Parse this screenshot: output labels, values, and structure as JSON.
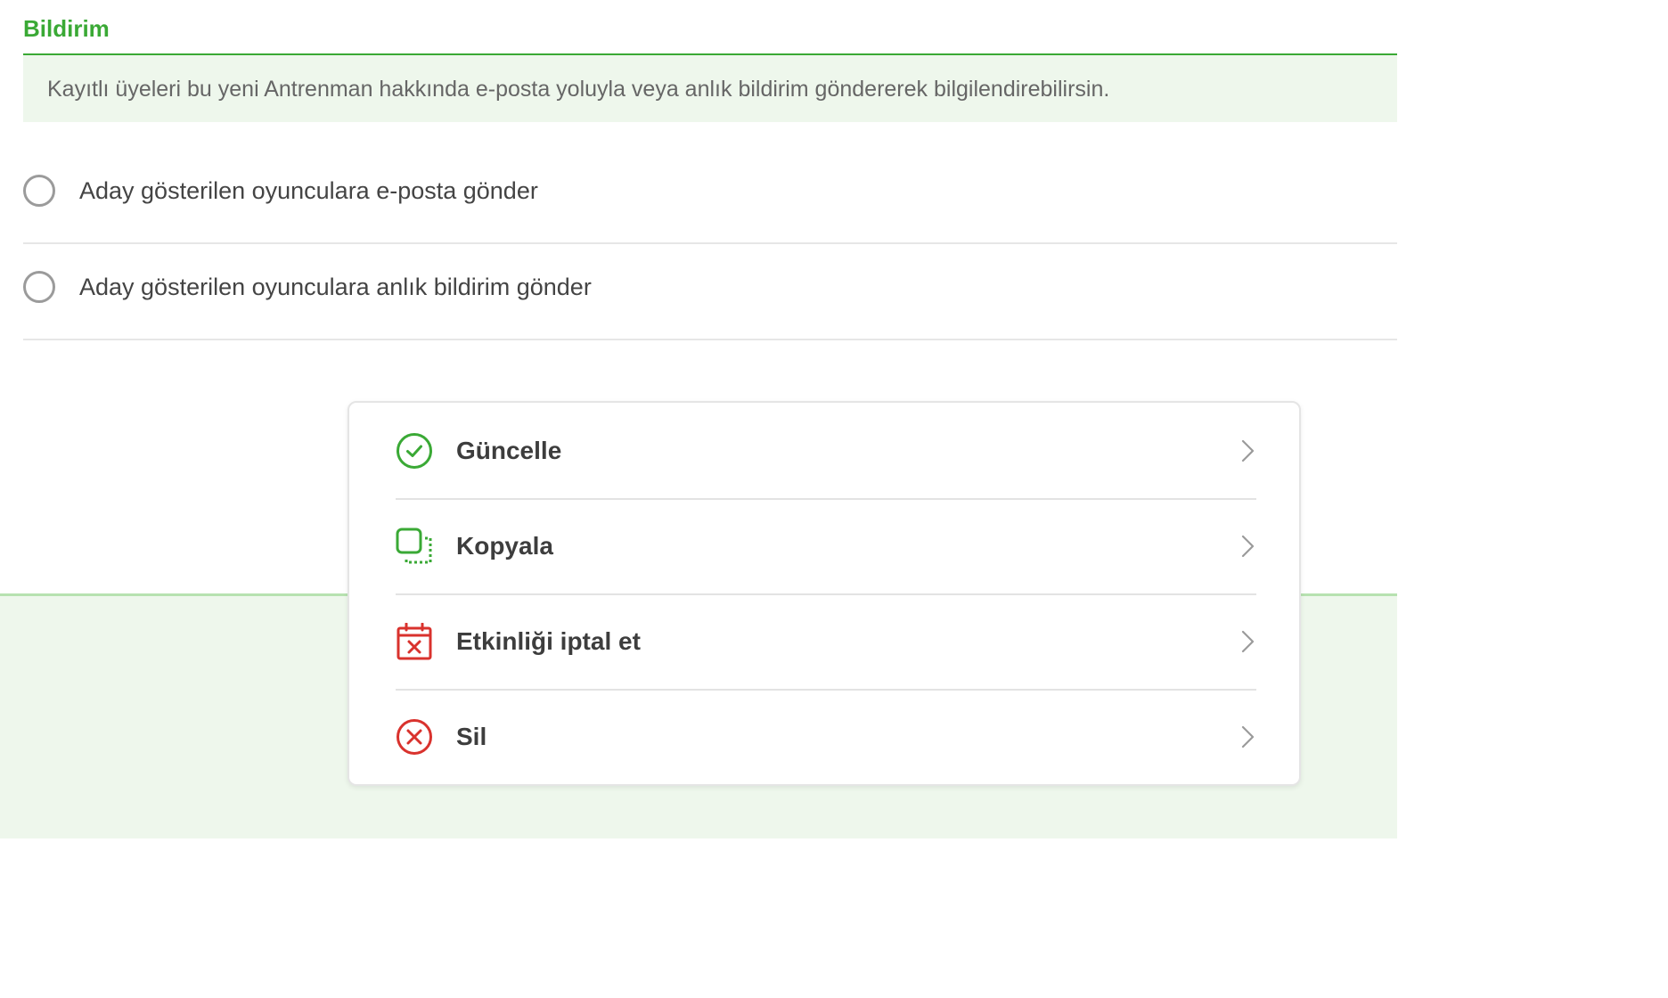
{
  "section": {
    "title": "Bildirim",
    "info": "Kayıtlı üyeleri bu yeni Antrenman hakkında e-posta yoluyla veya anlık bildirim göndererek bilgilendirebilirsin."
  },
  "options": [
    {
      "label": "Aday gösterilen oyunculara e-posta gönder",
      "checked": false
    },
    {
      "label": "Aday gösterilen oyunculara anlık bildirim gönder",
      "checked": false
    }
  ],
  "menu": {
    "items": [
      {
        "label": "Güncelle",
        "icon": "check-circle-icon",
        "color": "#3aa935"
      },
      {
        "label": "Kopyala",
        "icon": "copy-icon",
        "color": "#3aa935"
      },
      {
        "label": "Etkinliği iptal et",
        "icon": "calendar-cancel-icon",
        "color": "#d9322d"
      },
      {
        "label": "Sil",
        "icon": "x-circle-icon",
        "color": "#d9322d"
      }
    ]
  },
  "colors": {
    "brand_green": "#3aa935",
    "danger_red": "#d9322d",
    "info_bg": "#eef7ec",
    "text": "#3d3d3d"
  }
}
